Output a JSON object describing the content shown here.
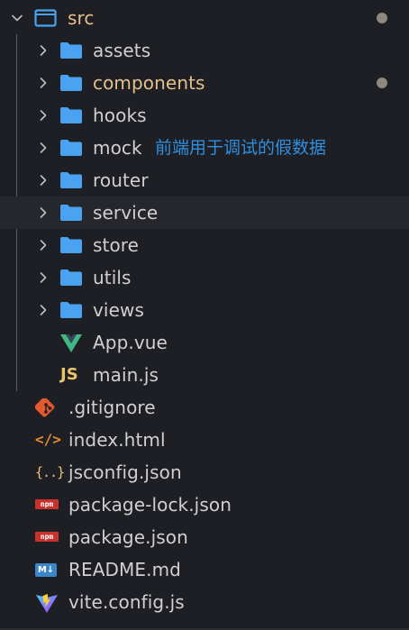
{
  "explorer": {
    "root": {
      "label": "src",
      "expanded": true,
      "modified": true
    },
    "folders": [
      {
        "label": "assets",
        "modified": false
      },
      {
        "label": "components",
        "modified": true
      },
      {
        "label": "hooks",
        "modified": false
      },
      {
        "label": "mock",
        "modified": false,
        "annotation": "前端用于调试的假数据"
      },
      {
        "label": "router",
        "modified": false
      },
      {
        "label": "service",
        "modified": false,
        "hovered": true
      },
      {
        "label": "store",
        "modified": false
      },
      {
        "label": "utils",
        "modified": false
      },
      {
        "label": "views",
        "modified": false
      }
    ],
    "src_files": [
      {
        "label": "App.vue",
        "icon": "vue-icon"
      },
      {
        "label": "main.js",
        "icon": "js-icon",
        "icon_text": "JS"
      }
    ],
    "root_files": [
      {
        "label": ".gitignore",
        "icon": "git-icon"
      },
      {
        "label": "index.html",
        "icon": "html-icon",
        "icon_text": "</>"
      },
      {
        "label": "jsconfig.json",
        "icon": "json-icon",
        "icon_text": "{..}"
      },
      {
        "label": "package-lock.json",
        "icon": "npm-icon",
        "icon_text": "npm"
      },
      {
        "label": "package.json",
        "icon": "npm-icon",
        "icon_text": "npm"
      },
      {
        "label": "README.md",
        "icon": "markdown-icon",
        "icon_text": "M↓"
      },
      {
        "label": "vite.config.js",
        "icon": "vite-icon"
      }
    ]
  },
  "colors": {
    "background": "#1d1f24",
    "folder": "#4aa3f0",
    "text": "#d0d0d0",
    "modified_text": "#e6c08a",
    "modified_dot": "#8d8a7c",
    "annotation": "#2f8fe0",
    "npm": "#c9312c",
    "vue_green": "#41b883",
    "vue_dark": "#35495e",
    "git": "#e4582d",
    "js": "#e9c46a",
    "markdown": "#3a86c8"
  }
}
